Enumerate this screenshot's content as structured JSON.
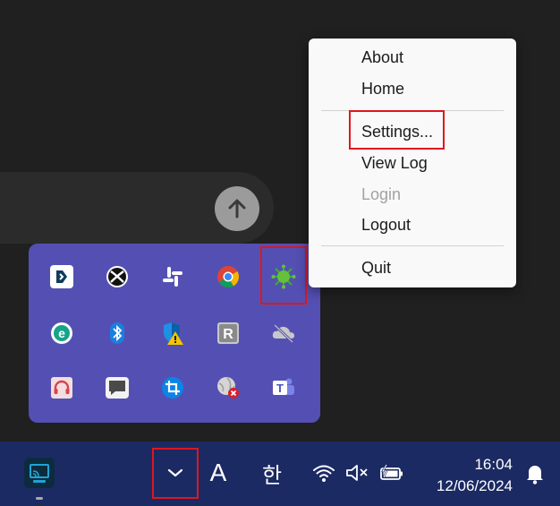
{
  "context_menu": {
    "items": [
      {
        "label": "About",
        "enabled": true
      },
      {
        "label": "Home",
        "enabled": true
      },
      {
        "label": "Settings...",
        "enabled": true,
        "highlighted": true
      },
      {
        "label": "View Log",
        "enabled": true
      },
      {
        "label": "Login",
        "enabled": false
      },
      {
        "label": "Logout",
        "enabled": true
      },
      {
        "label": "Quit",
        "enabled": true
      }
    ]
  },
  "tray_overflow": {
    "icons": [
      "dashlane-icon",
      "xbox-icon",
      "slack-icon",
      "chrome-icon",
      "green-virus-app-icon",
      "eset-icon",
      "bluetooth-icon",
      "defender-warning-icon",
      "r-app-icon",
      "onedrive-off-icon",
      "headset-icon",
      "chat-bubble-icon",
      "crop-tool-icon",
      "globe-error-icon",
      "teams-icon"
    ],
    "highlighted_icon": "green-virus-app-icon"
  },
  "taskbar": {
    "ime_label": "A",
    "language_label": "한",
    "time": "16:04",
    "date": "12/06/2024",
    "chevron_highlighted": true
  },
  "colors": {
    "tray_bg": "#5450b3",
    "taskbar_bg": "#1b2a63",
    "highlight": "#e0161f",
    "menu_bg": "#f9f9f9"
  }
}
